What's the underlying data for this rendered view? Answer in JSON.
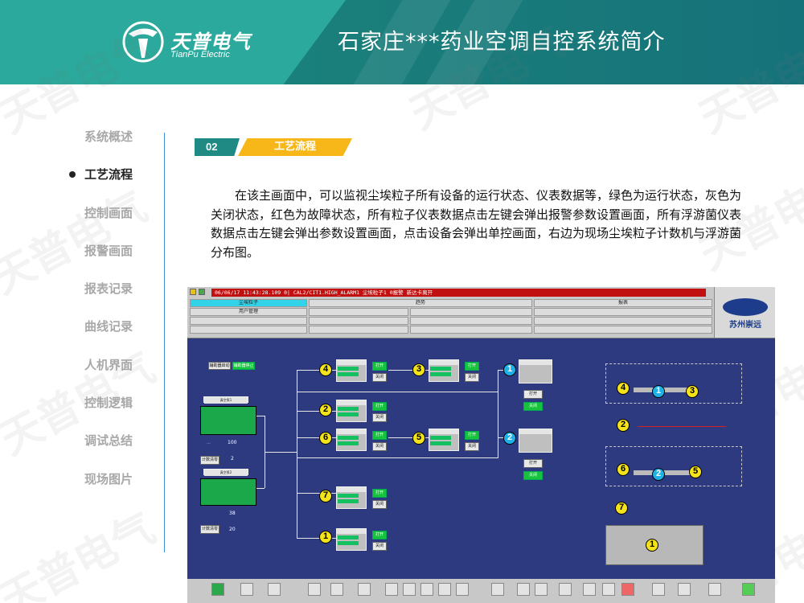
{
  "header": {
    "logo_cn": "天普电气",
    "logo_en": "TianPu Electric",
    "title": "石家庄***药业空调自控系统简介"
  },
  "watermark": "天普电气",
  "nav": {
    "items": [
      {
        "label": "系统概述",
        "active": false
      },
      {
        "label": "工艺流程",
        "active": true
      },
      {
        "label": "控制画面",
        "active": false
      },
      {
        "label": "报警画面",
        "active": false
      },
      {
        "label": "报表记录",
        "active": false
      },
      {
        "label": "曲线记录",
        "active": false
      },
      {
        "label": "人机界面",
        "active": false
      },
      {
        "label": "控制逻辑",
        "active": false
      },
      {
        "label": "调试总结",
        "active": false
      },
      {
        "label": "现场图片",
        "active": false
      }
    ]
  },
  "section": {
    "number": "02",
    "title": "工艺流程"
  },
  "paragraph": "在该主画面中，可以监视尘埃粒子所有设备的运行状态、仪表数据等，绿色为运行状态，灰色为关闭状态，红色为故障状态，所有粒子仪表数据点击左键会弹出报警参数设置画面，所有浮游菌仪表数据点击左键会弹出参数设置画面，点击设备会弹出单控画面，右边为现场尘埃粒子计数机与浮游菌分布图。",
  "hmi": {
    "status_bar": "06/06/17 11:43:28.109  0|            CAL2/CIT1.HIGH_ALARM1                                          尘埃粒子1  0报警   新达卡离开",
    "menu": {
      "row1": [
        "尘埃粒子",
        "趋势",
        "报表"
      ],
      "row2": [
        "用户管理"
      ]
    },
    "logo_text": "苏州崇远",
    "left_controls": {
      "btn1": "辅助器启动",
      "btn2": "辅助器停止",
      "unit1_label": "真空泵1",
      "unit2_label": "真空泵2",
      "value_a": "100",
      "value_b": "2",
      "value_c": "38",
      "value_d": "20",
      "counter_btn": "计数清零"
    },
    "nodes": [
      "4",
      "3",
      "1",
      "2",
      "6",
      "5",
      "2",
      "7",
      "1"
    ],
    "map_nodes": [
      "4",
      "1",
      "3",
      "2",
      "6",
      "2",
      "5",
      "7",
      "1"
    ],
    "btn_labels": {
      "open": "打开",
      "close": "关闭"
    }
  },
  "colors": {
    "teal": "#1e8a83",
    "yellow": "#f7b719",
    "hmi_bg": "#2e3a80",
    "run_green": "#14c060",
    "fault_red": "#c01010"
  }
}
